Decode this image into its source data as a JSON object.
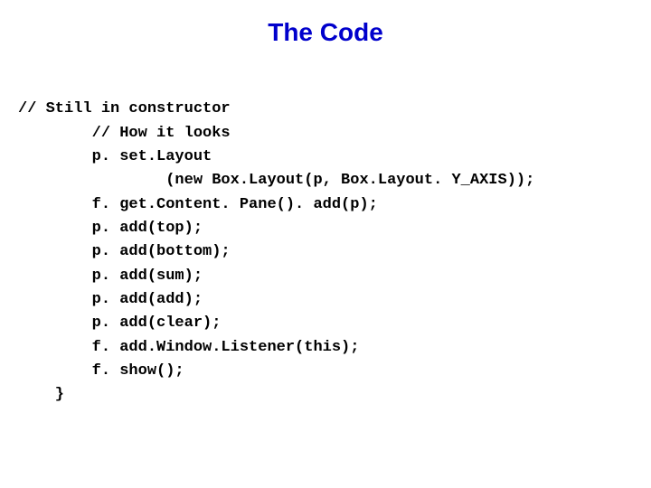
{
  "title": "The Code",
  "code": {
    "l1": "// Still in constructor",
    "l2": "        // How it looks",
    "l3": "        p. set.Layout",
    "l4": "                (new Box.Layout(p, Box.Layout. Y_AXIS));",
    "l5": "        f. get.Content. Pane(). add(p);",
    "l6": "        p. add(top);",
    "l7": "        p. add(bottom);",
    "l8": "        p. add(sum);",
    "l9": "        p. add(add);",
    "l10": "        p. add(clear);",
    "l11": "        f. add.Window.Listener(this);",
    "l12": "        f. show();",
    "l13": "    }"
  }
}
